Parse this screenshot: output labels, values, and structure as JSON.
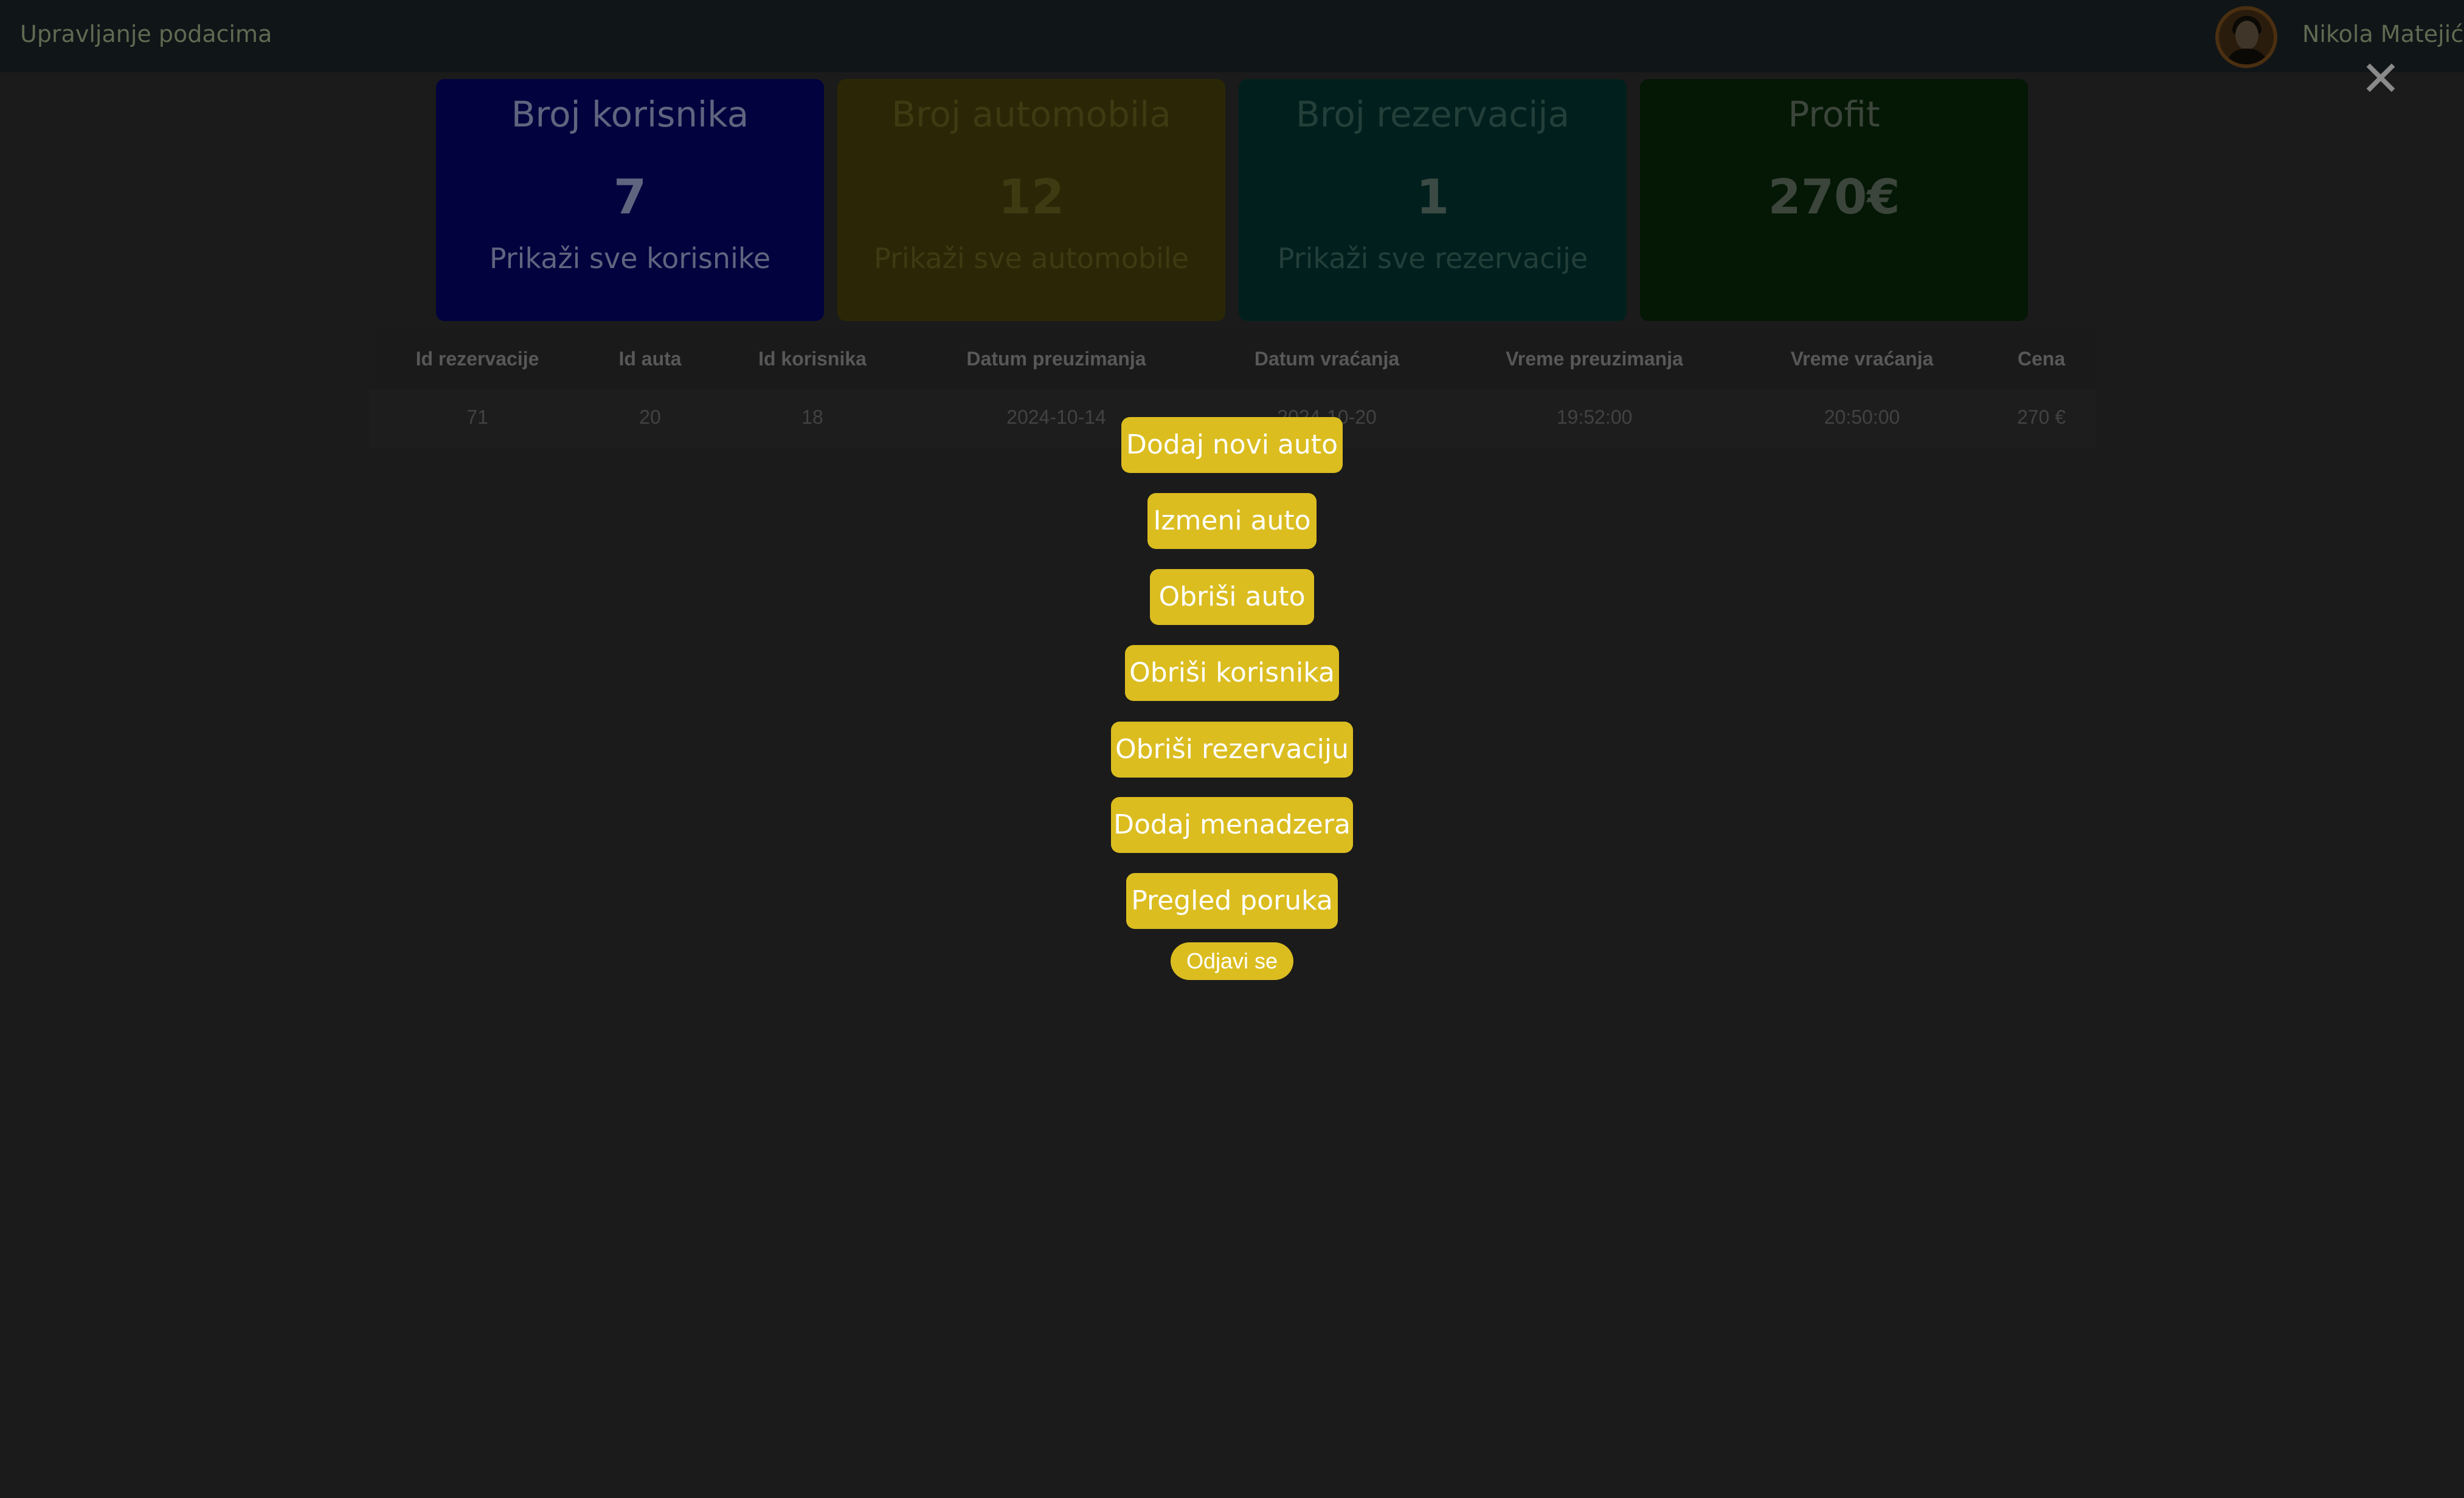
{
  "header": {
    "brand": "Upravljanje podacima",
    "user_name": "Nikola Matejić"
  },
  "overlay": {
    "close_glyph": "✕"
  },
  "stats": [
    {
      "title": "Broj korisnika",
      "value": "7",
      "link": "Prikaži sve korisnike"
    },
    {
      "title": "Broj automobila",
      "value": "12",
      "link": "Prikaži sve automobile"
    },
    {
      "title": "Broj rezervacija",
      "value": "1",
      "link": "Prikaži sve rezervacije"
    },
    {
      "title": "Profit",
      "value": "270€",
      "link": ""
    }
  ],
  "table": {
    "headers": [
      "Id rezervacije",
      "Id auta",
      "Id korisnika",
      "Datum preuzimanja",
      "Datum vraćanja",
      "Vreme preuzimanja",
      "Vreme vraćanja",
      "Cena"
    ],
    "rows": [
      [
        "71",
        "20",
        "18",
        "2024-10-14",
        "2024-10-20",
        "19:52:00",
        "20:50:00",
        "270 €"
      ]
    ]
  },
  "menu": {
    "items": [
      "Dodaj novi auto",
      "Izmeni auto",
      "Obriši auto",
      "Obriši korisnika",
      "Obriši rezervaciju",
      "Dodaj menadzera",
      "Pregled poruka"
    ],
    "logout": "Odjavi se"
  },
  "colors": {
    "background": "#1b1b1b",
    "button": "#dbbd20",
    "button_text": "#ffffff"
  }
}
